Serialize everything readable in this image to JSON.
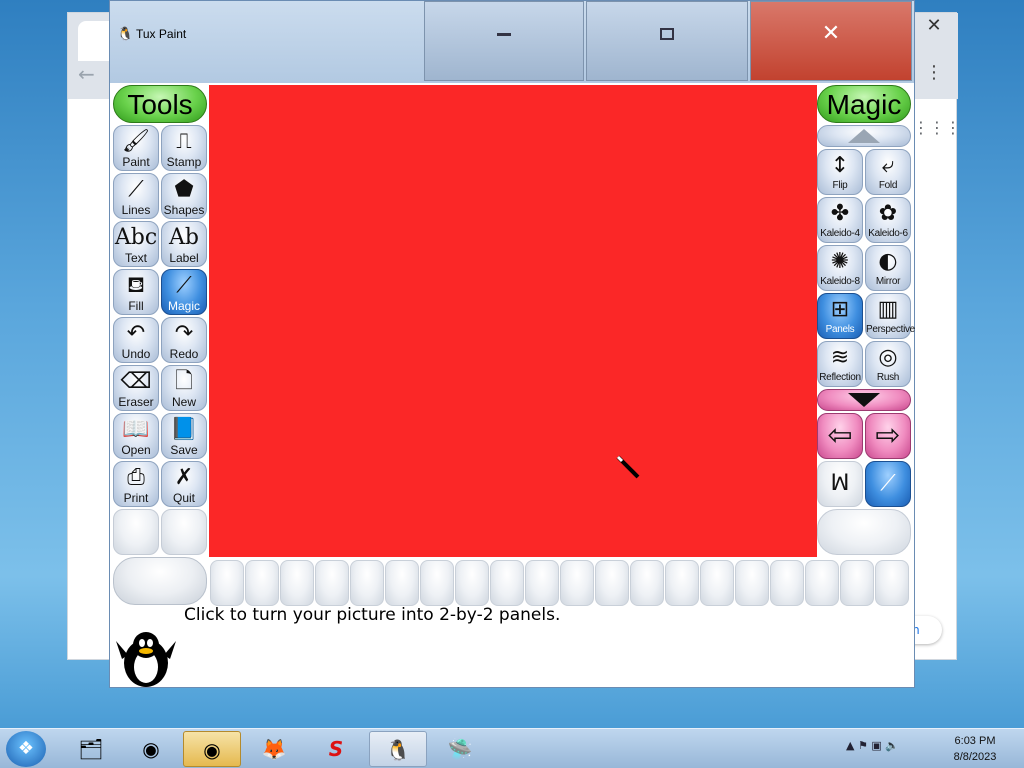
{
  "window": {
    "title": "Tux Paint",
    "close_glyph": "✕"
  },
  "browser": {
    "close_glyph": "✕",
    "back_glyph": "←",
    "menu_glyph": "⋮",
    "apps_glyph": "⋮⋮⋮",
    "pill_text": "m"
  },
  "tools": {
    "header": "Tools",
    "items": [
      {
        "label": "Paint",
        "icon": "paintbrush-icon"
      },
      {
        "label": "Stamp",
        "icon": "stamp-icon"
      },
      {
        "label": "Lines",
        "icon": "lines-icon"
      },
      {
        "label": "Shapes",
        "icon": "pentagon-icon"
      },
      {
        "label": "Text",
        "icon": "text-abc-icon"
      },
      {
        "label": "Label",
        "icon": "label-abc-icon"
      },
      {
        "label": "Fill",
        "icon": "paint-bucket-icon"
      },
      {
        "label": "Magic",
        "icon": "magic-wand-icon",
        "selected": true
      },
      {
        "label": "Undo",
        "icon": "undo-hand-icon"
      },
      {
        "label": "Redo",
        "icon": "redo-hand-icon"
      },
      {
        "label": "Eraser",
        "icon": "eraser-icon"
      },
      {
        "label": "New",
        "icon": "new-page-icon"
      },
      {
        "label": "Open",
        "icon": "open-book-icon"
      },
      {
        "label": "Save",
        "icon": "save-book-icon"
      },
      {
        "label": "Print",
        "icon": "printer-icon"
      },
      {
        "label": "Quit",
        "icon": "quit-x-icon"
      }
    ]
  },
  "magic": {
    "header": "Magic",
    "items": [
      {
        "label": "Flip",
        "icon": "flip-arrows-icon"
      },
      {
        "label": "Fold",
        "icon": "fold-icon"
      },
      {
        "label": "Kaleido-4",
        "icon": "kaleido-4-icon"
      },
      {
        "label": "Kaleido-6",
        "icon": "kaleido-6-icon"
      },
      {
        "label": "Kaleido-8",
        "icon": "kaleido-8-icon"
      },
      {
        "label": "Mirror",
        "icon": "mirror-icon"
      },
      {
        "label": "Panels",
        "icon": "panels-icon",
        "selected": true
      },
      {
        "label": "Perspective",
        "icon": "perspective-icon"
      },
      {
        "label": "Reflection",
        "icon": "reflection-icon"
      },
      {
        "label": "Rush",
        "icon": "rush-icon"
      }
    ]
  },
  "canvas": {
    "color": "#fb2727"
  },
  "status": {
    "message": "Click to turn your picture into 2-by-2 panels."
  },
  "taskbar": {
    "clock_time": "6:03 PM",
    "clock_date": "8/8/2023"
  }
}
